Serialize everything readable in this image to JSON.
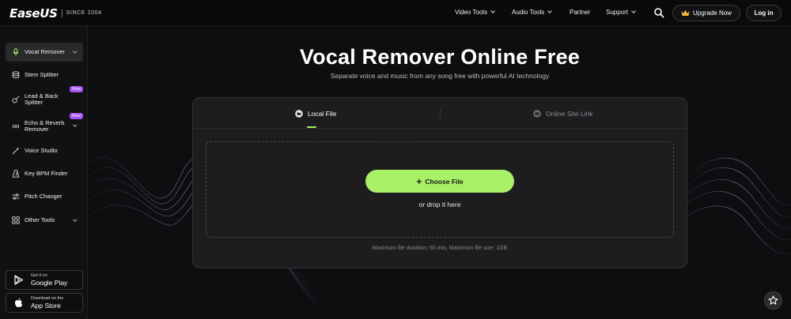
{
  "header": {
    "logo_text": "EaseUS",
    "logo_tagline": "SINCE 2004",
    "nav": [
      {
        "label": "Video Tools",
        "has_dropdown": true
      },
      {
        "label": "Audio Tools",
        "has_dropdown": true
      },
      {
        "label": "Partner",
        "has_dropdown": false
      },
      {
        "label": "Support",
        "has_dropdown": true
      }
    ],
    "search_icon": "search-icon",
    "upgrade_label": "Upgrade Now",
    "upgrade_icon": "crown-icon",
    "login_label": "Log in"
  },
  "sidebar": {
    "items": [
      {
        "label": "Vocal Remover",
        "icon": "microphone-icon",
        "active": true,
        "dropdown": true
      },
      {
        "label": "Stem Splitter",
        "icon": "database-icon"
      },
      {
        "label": "Lead & Back\nSplitter",
        "icon": "guitar-icon",
        "badge": "New"
      },
      {
        "label": "Echo & Reverb\nRemover",
        "icon": "echo-icon",
        "badge": "New",
        "dropdown": true
      },
      {
        "label": "Voice Studio",
        "icon": "magic-wand-icon"
      },
      {
        "label": "Key BPM Finder",
        "icon": "metronome-icon"
      },
      {
        "label": "Pitch Changer",
        "icon": "sliders-icon"
      },
      {
        "label": "Other Tools",
        "icon": "grid-icon",
        "dropdown": true
      }
    ],
    "stores": [
      {
        "small": "Get it on",
        "big": "Google Play",
        "icon": "google-play-icon"
      },
      {
        "small": "Download on the",
        "big": "App Store",
        "icon": "apple-icon"
      }
    ]
  },
  "main": {
    "title": "Vocal Remover Online Free",
    "subtitle": "Separate voice and music from any song free with powerful AI technology",
    "tabs": [
      {
        "label": "Local File",
        "icon": "folder-icon",
        "active": true
      },
      {
        "label": "Online Site Link",
        "icon": "video-link-icon",
        "active": false
      }
    ],
    "choose_file_label": "Choose File",
    "drop_text": "or drop it here",
    "max_note": "Maximum file duration: 60 min, Maximum file size: 1GB"
  },
  "colors": {
    "accent": "#a8f065",
    "badge": "#a855f7",
    "background": "#0e0e10",
    "card": "#1d1d20"
  },
  "floating": {
    "icon": "star-icon"
  }
}
